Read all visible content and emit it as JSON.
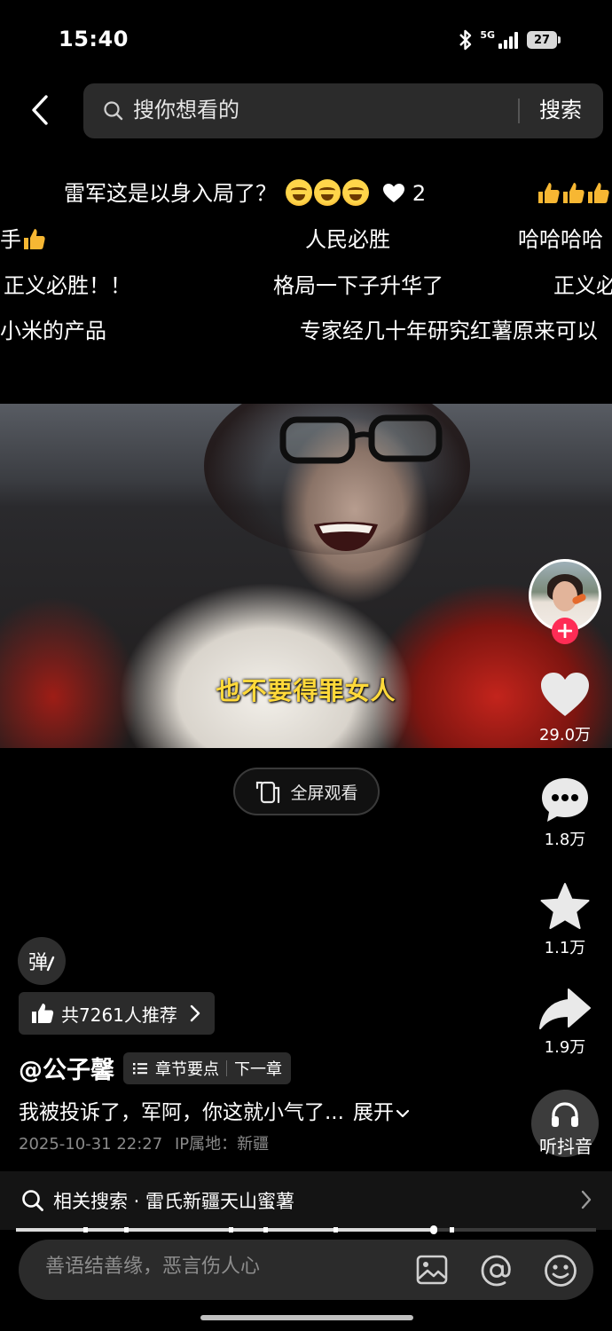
{
  "status": {
    "time": "15:40",
    "network": "5G",
    "battery": "27"
  },
  "search": {
    "placeholder": "搜你想看的",
    "button": "搜索"
  },
  "danmaku": [
    {
      "text": "雷军这是以身入局了？",
      "like_count": "2"
    },
    {
      "text": "人民必胜"
    },
    {
      "text": "哈哈哈哈"
    },
    {
      "text": "手"
    },
    {
      "text": "正义必胜！！"
    },
    {
      "text": "格局一下子升华了"
    },
    {
      "text": "正义必"
    },
    {
      "text": "小米的产品"
    },
    {
      "text": "专家经几十年研究红薯原来可以"
    }
  ],
  "video": {
    "subtitle": "也不要得罪女人"
  },
  "fullscreen": {
    "label": "全屏观看"
  },
  "rail": {
    "likes": "29.0万",
    "comments": "1.8万",
    "favorites": "1.1万",
    "shares": "1.9万",
    "listen": "听抖音"
  },
  "danmu_toggle": "弹",
  "recommend": {
    "label": "共7261人推荐"
  },
  "author": {
    "name": "@公子馨"
  },
  "chapter": {
    "points": "章节要点",
    "next": "下一章"
  },
  "caption": {
    "text": "我被投诉了，军阿，你这就小气了...",
    "expand": "展开"
  },
  "meta": {
    "date": "2025-10-31 22:27",
    "ip_label": "IP属地：新疆"
  },
  "related": {
    "text": "相关搜索 · 雷氏新疆天山蜜薯"
  },
  "progress": {
    "played_fraction": 0.72,
    "chapter_marks": [
      0.12,
      0.19,
      0.37,
      0.43,
      0.55,
      0.72,
      0.75
    ]
  },
  "comment": {
    "placeholder": "善语结善缘，恶言伤人心"
  },
  "colors": {
    "accent": "#fe2c55",
    "subtitle": "#ffd93a",
    "surface": "#2b2b2b"
  }
}
